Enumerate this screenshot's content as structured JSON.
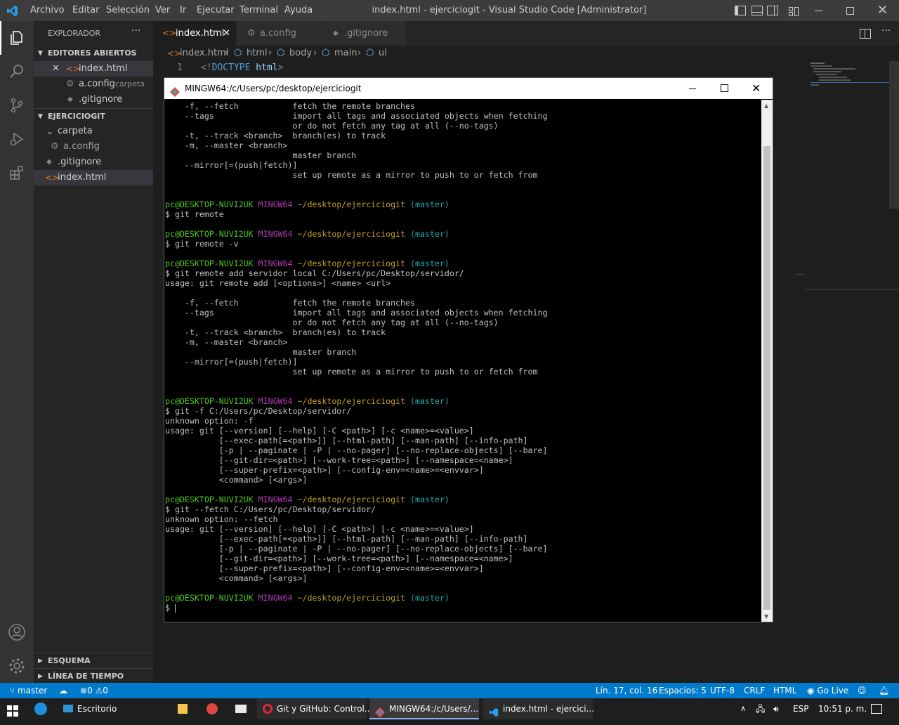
{
  "titlebar": {
    "menu": [
      "Archivo",
      "Editar",
      "Selección",
      "Ver",
      "Ir",
      "Ejecutar",
      "Terminal",
      "Ayuda"
    ],
    "title": "index.html - ejerciciogit - Visual Studio Code [Administrator]"
  },
  "sidebar": {
    "header": "EXPLORADOR",
    "open_editors_label": "EDITORES ABIERTOS",
    "open_editors": [
      {
        "name": "index.html",
        "desc": ""
      },
      {
        "name": "a.config",
        "desc": "carpeta"
      },
      {
        "name": ".gitignore",
        "desc": ""
      }
    ],
    "folder_label": "EJERCICIOGIT",
    "tree": [
      {
        "name": "carpeta"
      },
      {
        "name": "a.config"
      },
      {
        "name": ".gitignore"
      },
      {
        "name": "index.html"
      }
    ],
    "outline_label": "ESQUEMA",
    "timeline_label": "LÍNEA DE TIEMPO"
  },
  "tabs": [
    {
      "label": "index.html",
      "active": true
    },
    {
      "label": "a.config",
      "active": false
    },
    {
      "label": ".gitignore",
      "active": false
    }
  ],
  "breadcrumb": [
    "index.html",
    "html",
    "body",
    "main",
    "ul"
  ],
  "editor": {
    "line_number": "1",
    "line_lt": "<!",
    "line_kw": "DOCTYPE",
    "line_rest": " html",
    "line_gt": ">"
  },
  "terminal": {
    "title": "MINGW64:/c/Users/pc/desktop/ejerciciogit",
    "lines": [
      [
        "    -f, --fetch           fetch the remote branches"
      ],
      [
        "    --tags                import all tags and associated objects when fetching"
      ],
      [
        "                          or do not fetch any tag at all (--no-tags)"
      ],
      [
        "    -t, --track <branch>  branch(es) to track"
      ],
      [
        "    -m, --master <branch>"
      ],
      [
        "                          master branch"
      ],
      [
        "    --mirror[=(push|fetch)]"
      ],
      [
        "                          set up remote as a mirror to push to or fetch from"
      ],
      [
        ""
      ],
      [
        ""
      ],
      [
        "pc@DESKTOP-NUVI2UK",
        " ",
        "MINGW64",
        " ",
        "~/desktop/ejerciciogit",
        " ",
        "(master)"
      ],
      [
        "$ git remote"
      ],
      [
        ""
      ],
      [
        "pc@DESKTOP-NUVI2UK",
        " ",
        "MINGW64",
        " ",
        "~/desktop/ejerciciogit",
        " ",
        "(master)"
      ],
      [
        "$ git remote -v"
      ],
      [
        ""
      ],
      [
        "pc@DESKTOP-NUVI2UK",
        " ",
        "MINGW64",
        " ",
        "~/desktop/ejerciciogit",
        " ",
        "(master)"
      ],
      [
        "$ git remote add servidor local C:/Users/pc/Desktop/servidor/"
      ],
      [
        "usage: git remote add [<options>] <name> <url>"
      ],
      [
        ""
      ],
      [
        "    -f, --fetch           fetch the remote branches"
      ],
      [
        "    --tags                import all tags and associated objects when fetching"
      ],
      [
        "                          or do not fetch any tag at all (--no-tags)"
      ],
      [
        "    -t, --track <branch>  branch(es) to track"
      ],
      [
        "    -m, --master <branch>"
      ],
      [
        "                          master branch"
      ],
      [
        "    --mirror[=(push|fetch)]"
      ],
      [
        "                          set up remote as a mirror to push to or fetch from"
      ],
      [
        ""
      ],
      [
        ""
      ],
      [
        "pc@DESKTOP-NUVI2UK",
        " ",
        "MINGW64",
        " ",
        "~/desktop/ejerciciogit",
        " ",
        "(master)"
      ],
      [
        "$ git -f C:/Users/pc/Desktop/servidor/"
      ],
      [
        "unknown option: -f"
      ],
      [
        "usage: git [--version] [--help] [-C <path>] [-c <name>=<value>]"
      ],
      [
        "           [--exec-path[=<path>]] [--html-path] [--man-path] [--info-path]"
      ],
      [
        "           [-p | --paginate | -P | --no-pager] [--no-replace-objects] [--bare]"
      ],
      [
        "           [--git-dir=<path>] [--work-tree=<path>] [--namespace=<name>]"
      ],
      [
        "           [--super-prefix=<path>] [--config-env=<name>=<envvar>]"
      ],
      [
        "           <command> [<args>]"
      ],
      [
        ""
      ],
      [
        "pc@DESKTOP-NUVI2UK",
        " ",
        "MINGW64",
        " ",
        "~/desktop/ejerciciogit",
        " ",
        "(master)"
      ],
      [
        "$ git --fetch C:/Users/pc/Desktop/servidor/"
      ],
      [
        "unknown option: --fetch"
      ],
      [
        "usage: git [--version] [--help] [-C <path>] [-c <name>=<value>]"
      ],
      [
        "           [--exec-path[=<path>]] [--html-path] [--man-path] [--info-path]"
      ],
      [
        "           [-p | --paginate | -P | --no-pager] [--no-replace-objects] [--bare]"
      ],
      [
        "           [--git-dir=<path>] [--work-tree=<path>] [--namespace=<name>]"
      ],
      [
        "           [--super-prefix=<path>] [--config-env=<name>=<envvar>]"
      ],
      [
        "           <command> [<args>]"
      ],
      [
        ""
      ],
      [
        "pc@DESKTOP-NUVI2UK",
        " ",
        "MINGW64",
        " ",
        "~/desktop/ejerciciogit",
        " ",
        "(master)"
      ],
      [
        "$ "
      ]
    ]
  },
  "statusbar": {
    "branch": "master",
    "errors": "0",
    "warnings": "0",
    "position": "Lín. 17, col. 16",
    "spaces": "Espacios: 5",
    "encoding": "UTF-8",
    "eol": "CRLF",
    "language": "HTML",
    "golive": "Go Live"
  },
  "taskbar": {
    "items": [
      "Escritorio",
      "Git y GitHub: Control...",
      "MINGW64:/c/Users/...",
      "index.html - ejercici..."
    ],
    "lang": "ESP",
    "time": "10:51 p. m."
  },
  "colors": {
    "accent": "#007acc",
    "prompt_user": "#4ec921",
    "prompt_shell": "#b03ab2",
    "prompt_path": "#c0a020",
    "prompt_branch": "#1fa6a6"
  }
}
